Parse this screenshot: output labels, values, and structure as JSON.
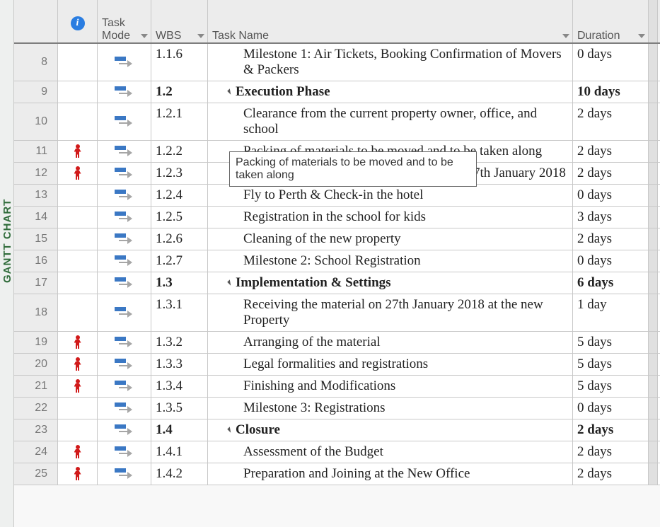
{
  "sidebar_label": "GANTT CHART",
  "headers": {
    "info": "i",
    "task_mode": "Task Mode",
    "wbs": "WBS",
    "task_name": "Task Name",
    "duration": "Duration"
  },
  "tooltip": "Packing of materials to be moved and to be taken along",
  "rows": [
    {
      "num": "8",
      "info": "",
      "wbs": "1.1.6",
      "bold": false,
      "indent": 2,
      "collapse": false,
      "name": "Milestone 1: Air Tickets, Booking Confirmation of Movers & Packers",
      "duration": "0 days"
    },
    {
      "num": "9",
      "info": "",
      "wbs": "1.2",
      "bold": true,
      "indent": 1,
      "collapse": true,
      "name": "Execution Phase",
      "duration": "10 days"
    },
    {
      "num": "10",
      "info": "",
      "wbs": "1.2.1",
      "bold": false,
      "indent": 2,
      "collapse": false,
      "name": "Clearance from the current property owner, office, and school",
      "duration": "2 days"
    },
    {
      "num": "11",
      "info": "person",
      "wbs": "1.2.2",
      "bold": false,
      "indent": 2,
      "collapse": false,
      "name": "Packing of materials to be moved and to be taken along",
      "duration": "2 days"
    },
    {
      "num": "12",
      "info": "person",
      "wbs": "1.2.3",
      "bold": false,
      "indent": 2,
      "collapse": false,
      "name": "Moving of the material to be received on 27th January 2018",
      "duration": "2 days"
    },
    {
      "num": "13",
      "info": "",
      "wbs": "1.2.4",
      "bold": false,
      "indent": 2,
      "collapse": false,
      "name": "Fly to Perth & Check-in the hotel",
      "duration": "0 days"
    },
    {
      "num": "14",
      "info": "",
      "wbs": "1.2.5",
      "bold": false,
      "indent": 2,
      "collapse": false,
      "name": "Registration in the school for kids",
      "duration": "3 days"
    },
    {
      "num": "15",
      "info": "",
      "wbs": "1.2.6",
      "bold": false,
      "indent": 2,
      "collapse": false,
      "name": "Cleaning of the new property",
      "duration": "2 days"
    },
    {
      "num": "16",
      "info": "",
      "wbs": "1.2.7",
      "bold": false,
      "indent": 2,
      "collapse": false,
      "name": "Milestone 2: School Registration",
      "duration": "0 days"
    },
    {
      "num": "17",
      "info": "",
      "wbs": "1.3",
      "bold": true,
      "indent": 1,
      "collapse": true,
      "name": "Implementation & Settings",
      "duration": "6 days"
    },
    {
      "num": "18",
      "info": "",
      "wbs": "1.3.1",
      "bold": false,
      "indent": 2,
      "collapse": false,
      "name": "Receiving the material on 27th January 2018 at the new Property",
      "duration": "1 day"
    },
    {
      "num": "19",
      "info": "person",
      "wbs": "1.3.2",
      "bold": false,
      "indent": 2,
      "collapse": false,
      "name": "Arranging of the material",
      "duration": "5 days"
    },
    {
      "num": "20",
      "info": "person",
      "wbs": "1.3.3",
      "bold": false,
      "indent": 2,
      "collapse": false,
      "name": "Legal formalities and registrations",
      "duration": "5 days"
    },
    {
      "num": "21",
      "info": "person",
      "wbs": "1.3.4",
      "bold": false,
      "indent": 2,
      "collapse": false,
      "name": "Finishing and Modifications",
      "duration": "5 days"
    },
    {
      "num": "22",
      "info": "",
      "wbs": "1.3.5",
      "bold": false,
      "indent": 2,
      "collapse": false,
      "name": "Milestone 3: Registrations",
      "duration": "0 days"
    },
    {
      "num": "23",
      "info": "",
      "wbs": "1.4",
      "bold": true,
      "indent": 1,
      "collapse": true,
      "name": "Closure",
      "duration": "2 days"
    },
    {
      "num": "24",
      "info": "person",
      "wbs": "1.4.1",
      "bold": false,
      "indent": 2,
      "collapse": false,
      "name": "Assessment of the Budget",
      "duration": "2 days"
    },
    {
      "num": "25",
      "info": "person",
      "wbs": "1.4.2",
      "bold": false,
      "indent": 2,
      "collapse": false,
      "name": "Preparation and Joining at the New Office",
      "duration": "2 days"
    }
  ]
}
